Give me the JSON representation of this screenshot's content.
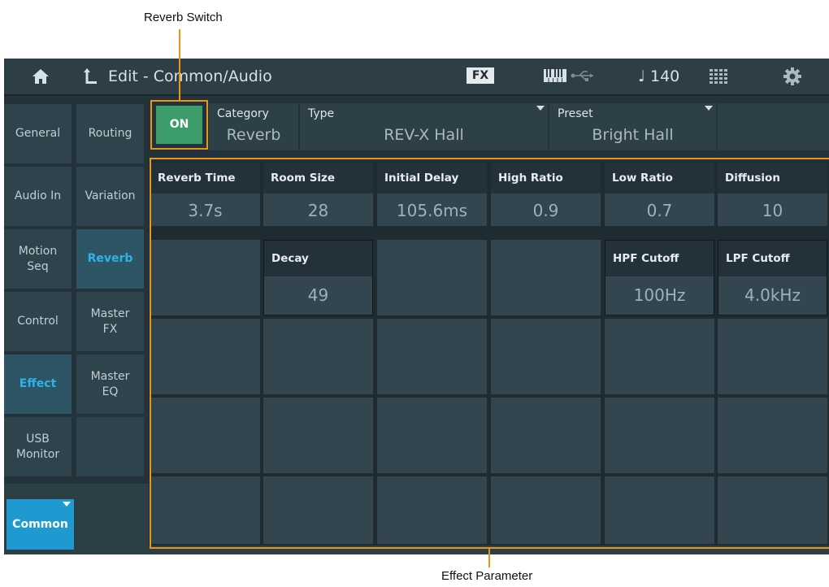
{
  "callouts": {
    "reverb_switch": "Reverb Switch",
    "effect_parameter": "Effect Parameter"
  },
  "header": {
    "title": "Edit - Common/Audio",
    "fx_badge": "FX",
    "tempo": "♩ 140"
  },
  "left_nav": [
    "General",
    "Audio In",
    "Motion\nSeq",
    "Control",
    "Effect",
    "USB\nMonitor"
  ],
  "sub_nav": [
    "Routing",
    "Variation",
    "Reverb",
    "Master\nFX",
    "Master\nEQ"
  ],
  "bottom_tab": "Common",
  "switch_label": "ON",
  "category": {
    "label": "Category",
    "value": "Reverb"
  },
  "type": {
    "label": "Type",
    "value": "REV-X Hall"
  },
  "preset": {
    "label": "Preset",
    "value": "Bright Hall"
  },
  "params_row1": [
    {
      "label": "Reverb Time",
      "value": "3.7s"
    },
    {
      "label": "Room Size",
      "value": "28"
    },
    {
      "label": "Initial Delay",
      "value": "105.6ms"
    },
    {
      "label": "High Ratio",
      "value": "0.9"
    },
    {
      "label": "Low Ratio",
      "value": "0.7"
    },
    {
      "label": "Diffusion",
      "value": "10"
    }
  ],
  "params_row2": [
    {
      "label": "Decay",
      "value": "49"
    },
    {
      "label": "HPF Cutoff",
      "value": "100Hz"
    },
    {
      "label": "LPF Cutoff",
      "value": "4.0kHz"
    }
  ],
  "colors": {
    "accent_blue": "#2eb3e8",
    "switch_green": "#3c9d6b",
    "callout_orange": "#e8951a"
  }
}
